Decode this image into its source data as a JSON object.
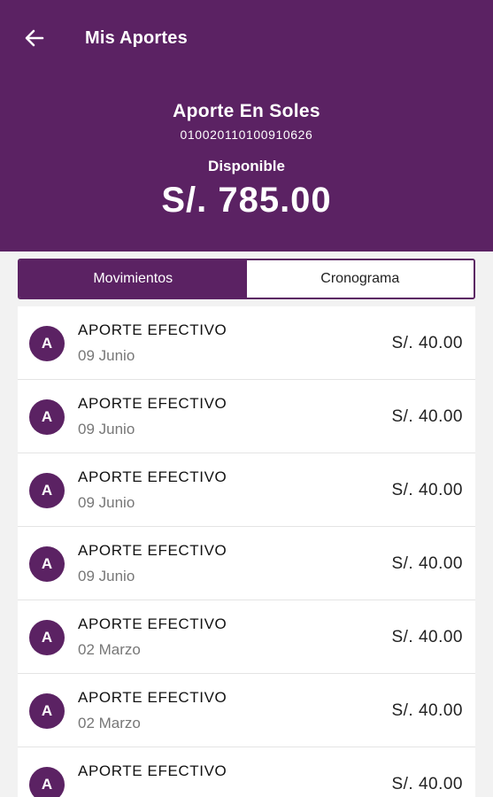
{
  "topbar": {
    "title": "Mis Aportes",
    "back_icon": "arrow-left-icon"
  },
  "account": {
    "name": "Aporte En Soles",
    "number": "010020110100910626",
    "available_label": "Disponible",
    "available_amount": "S/. 785.00"
  },
  "tabs": [
    {
      "label": "Movimientos",
      "active": true
    },
    {
      "label": "Cronograma",
      "active": false
    }
  ],
  "movements": [
    {
      "avatar": "A",
      "title": "APORTE EFECTIVO",
      "date": "09 Junio",
      "amount": "S/. 40.00"
    },
    {
      "avatar": "A",
      "title": "APORTE EFECTIVO",
      "date": "09 Junio",
      "amount": "S/. 40.00"
    },
    {
      "avatar": "A",
      "title": "APORTE EFECTIVO",
      "date": "09 Junio",
      "amount": "S/. 40.00"
    },
    {
      "avatar": "A",
      "title": "APORTE EFECTIVO",
      "date": "09 Junio",
      "amount": "S/. 40.00"
    },
    {
      "avatar": "A",
      "title": "APORTE EFECTIVO",
      "date": "02 Marzo",
      "amount": "S/. 40.00"
    },
    {
      "avatar": "A",
      "title": "APORTE EFECTIVO",
      "date": "02 Marzo",
      "amount": "S/. 40.00"
    },
    {
      "avatar": "A",
      "title": "APORTE EFECTIVO",
      "date": "",
      "amount": "S/. 40.00"
    }
  ],
  "colors": {
    "brand": "#5b2263",
    "background": "#f2f2f2"
  }
}
